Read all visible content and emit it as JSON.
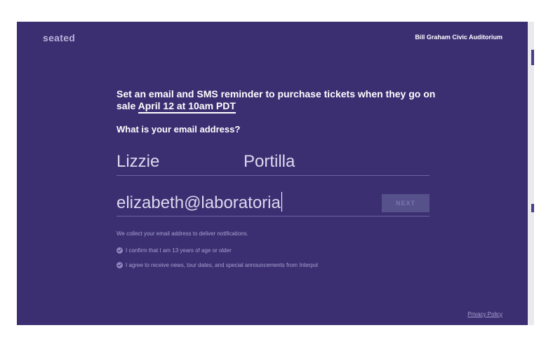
{
  "header": {
    "brand": "seated",
    "venue": "Bill Graham Civic Auditorium"
  },
  "main": {
    "headline_prefix": "Set an email and SMS reminder to purchase tickets when they go on sale ",
    "headline_date": "April 12 at 10am PDT",
    "question": "What is your email address?",
    "first_name": "Lizzie",
    "last_name": "Portilla",
    "email_value": "elizabeth@laboratoria",
    "next_label": "NEXT",
    "notice": "We collect your email address to deliver notifications.",
    "checks": [
      "I confirm that I am 13 years of age or older",
      "I agree to receive news, tour dates, and special announcements from Interpol"
    ]
  },
  "footer": {
    "privacy_label": "Privacy Policy"
  },
  "colors": {
    "background": "#3b2f72",
    "text": "#ffffff",
    "muted": "#a9a2cf",
    "button": "#56508b"
  }
}
